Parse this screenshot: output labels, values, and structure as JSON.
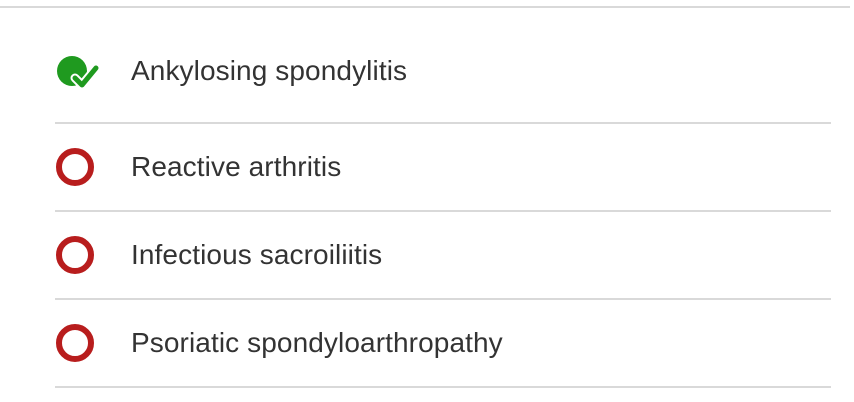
{
  "question": {
    "options": [
      {
        "label": "Ankylosing spondylitis",
        "status": "correct",
        "icon": "checkmark-correct-icon"
      },
      {
        "label": "Reactive arthritis",
        "status": "unselected",
        "icon": "radio-circle-icon"
      },
      {
        "label": "Infectious sacroiliitis",
        "status": "unselected",
        "icon": "radio-circle-icon"
      },
      {
        "label": "Psoriatic spondyloarthropathy",
        "status": "unselected",
        "icon": "radio-circle-icon"
      }
    ]
  },
  "colors": {
    "correct_green": "#1f9a1f",
    "radio_red": "#b81d1d",
    "divider": "#d9d9d9",
    "text": "#333333"
  }
}
